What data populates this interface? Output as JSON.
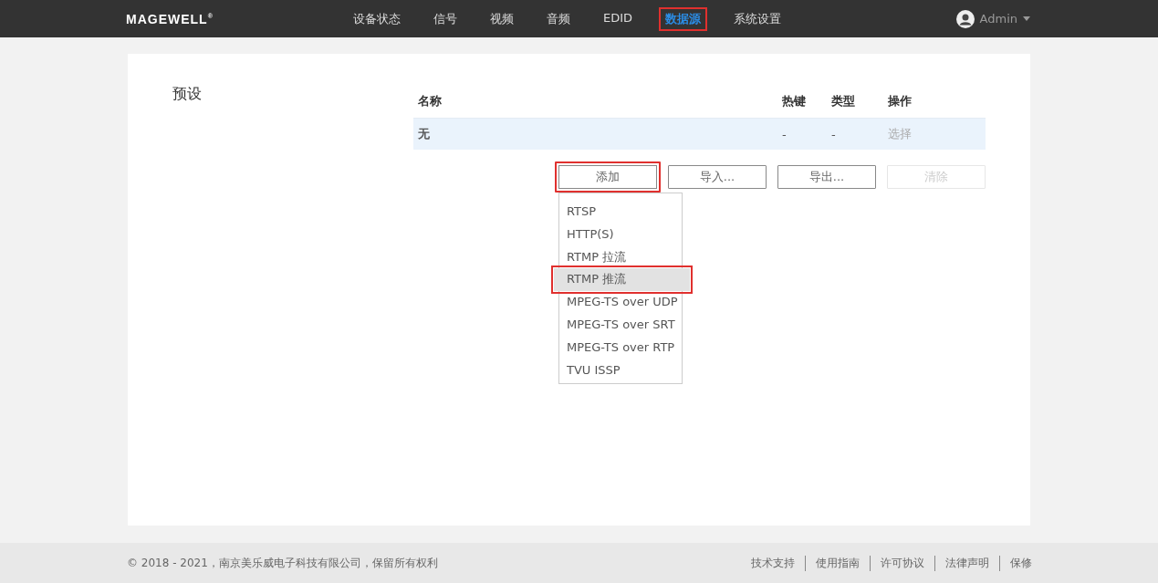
{
  "header": {
    "logo": "MAGEWELL",
    "logo_mark": "®",
    "nav": [
      {
        "label": "设备状态",
        "selected": false,
        "annotated": false
      },
      {
        "label": "信号",
        "selected": false,
        "annotated": false
      },
      {
        "label": "视频",
        "selected": false,
        "annotated": false
      },
      {
        "label": "音频",
        "selected": false,
        "annotated": false
      },
      {
        "label": "EDID",
        "selected": false,
        "annotated": false
      },
      {
        "label": "数据源",
        "selected": true,
        "annotated": true
      },
      {
        "label": "系统设置",
        "selected": false,
        "annotated": false
      }
    ],
    "user": "Admin"
  },
  "section_title": "预设",
  "table": {
    "columns": [
      "名称",
      "热键",
      "类型",
      "操作"
    ],
    "rows": [
      {
        "name": "无",
        "hotkey": "-",
        "type": "-",
        "action": "选择",
        "selected": true
      }
    ]
  },
  "buttons": [
    {
      "label": "添加",
      "disabled": false,
      "annotated": true
    },
    {
      "label": "导入...",
      "disabled": false,
      "annotated": false
    },
    {
      "label": "导出...",
      "disabled": false,
      "annotated": false
    },
    {
      "label": "清除",
      "disabled": true,
      "annotated": false
    }
  ],
  "add_menu": [
    {
      "label": "RTSP",
      "selected": false,
      "annotated": false
    },
    {
      "label": "HTTP(S)",
      "selected": false,
      "annotated": false
    },
    {
      "label": "RTMP 拉流",
      "selected": false,
      "annotated": false
    },
    {
      "label": "RTMP 推流",
      "selected": true,
      "annotated": true
    },
    {
      "label": "MPEG-TS over UDP",
      "selected": false,
      "annotated": false
    },
    {
      "label": "MPEG-TS over SRT",
      "selected": false,
      "annotated": false
    },
    {
      "label": "MPEG-TS over RTP",
      "selected": false,
      "annotated": false
    },
    {
      "label": "TVU ISSP",
      "selected": false,
      "annotated": false
    }
  ],
  "footer": {
    "copyright": "© 2018 - 2021，南京美乐威电子科技有限公司，保留所有权利",
    "links": [
      "技术支持",
      "使用指南",
      "许可协议",
      "法律声明",
      "保修"
    ]
  }
}
